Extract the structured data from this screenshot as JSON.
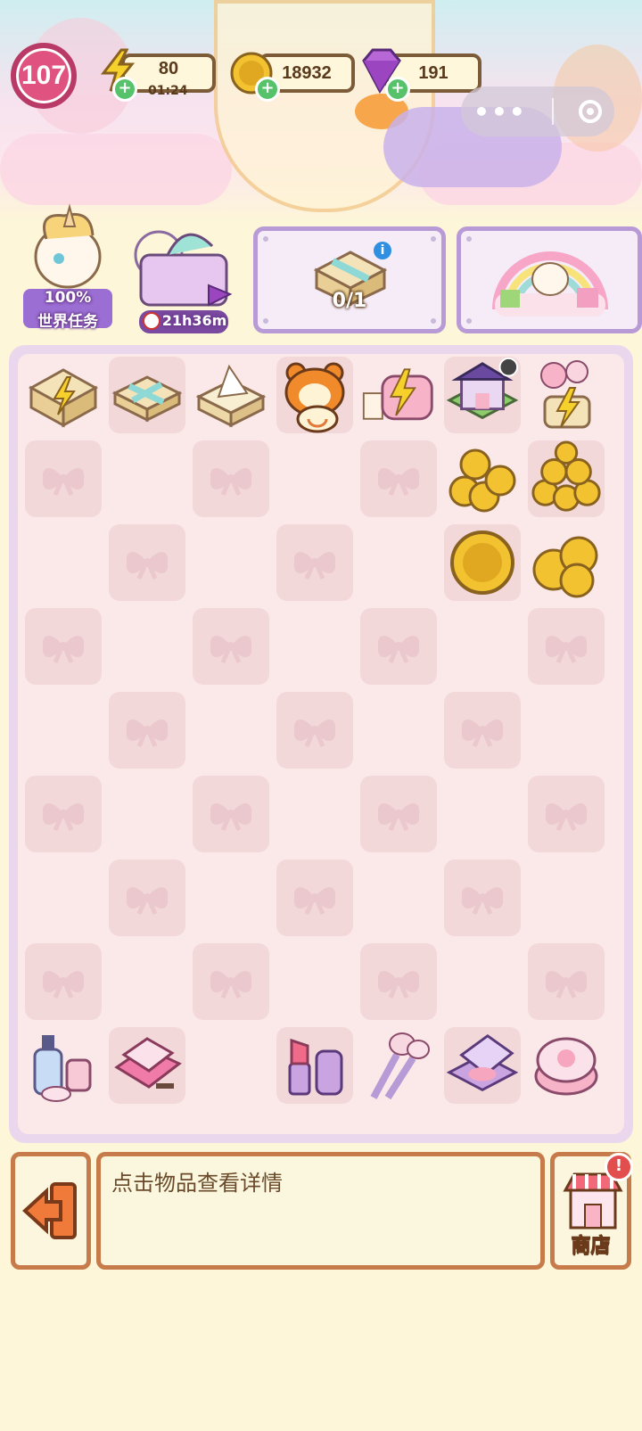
{
  "hud": {
    "level": "107",
    "energy": {
      "value": "80",
      "timer": "01:24"
    },
    "coins": {
      "value": "18932"
    },
    "gems": {
      "value": "191"
    }
  },
  "features": {
    "world_task_percent": "100%",
    "world_task_label": "世界任务",
    "event_timer": "21h36m",
    "order_progress": "0/1"
  },
  "board": {
    "rows": [
      [
        "gift-energy",
        "gift-ribbon",
        "gift-box-open",
        "panda-bear",
        "energy-vanity",
        "house-building",
        "balloon-energy"
      ],
      [
        "",
        "",
        "",
        "",
        "",
        "coin-stack-medium",
        "coin-pile-large"
      ],
      [
        "",
        "",
        "",
        "",
        "",
        "coin-single",
        "coin-stack-small"
      ],
      [
        "",
        "",
        "",
        "",
        "",
        "",
        ""
      ],
      [
        "",
        "",
        "",
        "",
        "",
        "",
        ""
      ],
      [
        "",
        "",
        "",
        "",
        "",
        "",
        ""
      ],
      [
        "",
        "",
        "",
        "",
        "",
        "",
        ""
      ],
      [
        "",
        "",
        "",
        "",
        "",
        "",
        ""
      ],
      [
        "cosmetic-bottles",
        "eyeshadow-palette",
        "",
        "lipstick-set",
        "makeup-brushes",
        "compact-mirror",
        "powder-puff"
      ]
    ]
  },
  "bottom": {
    "info_text": "点击物品查看详情",
    "shop_label": "商店"
  }
}
